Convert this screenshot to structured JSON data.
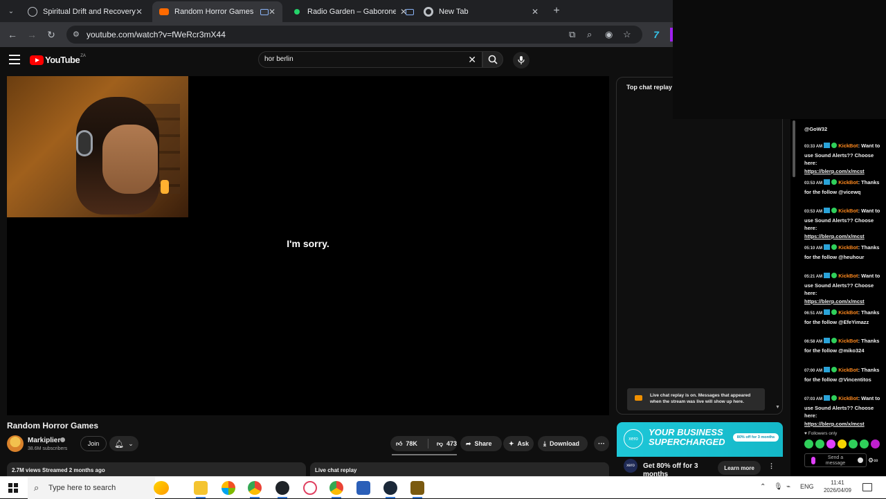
{
  "browser": {
    "tabs": [
      {
        "title": "Spiritual Drift and Recovery",
        "icon": "globe-icon",
        "active": false
      },
      {
        "title": "Random Horror Games - Yo",
        "icon": "youtube-icon",
        "active": true
      },
      {
        "title": "Radio Garden – Gaborone",
        "icon": "radio-garden-icon",
        "active": false
      },
      {
        "title": "New Tab",
        "icon": "chrome-icon",
        "active": false
      }
    ],
    "new_tab_label": "+",
    "url": "youtube.com/watch?v=fWeRcr3mX44"
  },
  "youtube": {
    "logo_text": "YouTube",
    "country_code": "ZA",
    "search_query": "hor berlin",
    "subtitle": "I'm sorry.",
    "video_title": "Random Horror Games",
    "channel": {
      "name": "Markiplier",
      "subscribers": "38.6M subscribers"
    },
    "join_label": "Join",
    "actions": {
      "likes": "78K",
      "dislikes": "473",
      "share": "Share",
      "ask": "Ask",
      "download": "Download",
      "more": "···"
    },
    "description_meta": "2.7M views  Streamed 2 months ago",
    "live_chat_replay_label": "Live chat replay",
    "chat": {
      "header": "Top chat replay",
      "replay_notice": "Live chat replay is on. Messages that appeared when the stream was live will show up here."
    },
    "ad": {
      "brand": "xero",
      "headline": "YOUR BUSINESS SUPERCHARGED",
      "offer_pill": "80% off for 3 months",
      "text": "Get 80% off for 3 months",
      "cta": "Learn more",
      "more": "⋮"
    }
  },
  "kick_chat": {
    "top_user": "@GoW32",
    "messages": [
      {
        "time": "03:33 AM",
        "user": "KickBot",
        "text": "Want to use Sound Alerts?? Choose here:",
        "link": "https://blerp.com/x/mcst"
      },
      {
        "time": "03:53 AM",
        "user": "KickBot",
        "text": "Thanks for the follow @vicewq",
        "link": ""
      },
      {
        "time": "03:53 AM",
        "user": "KickBot",
        "text": "Want to use Sound Alerts?? Choose here:",
        "link": "https://blerp.com/x/mcst"
      },
      {
        "time": "05:10 AM",
        "user": "KickBot",
        "text": "Thanks for the follow @heuhour",
        "link": ""
      },
      {
        "time": "05:21 AM",
        "user": "KickBot",
        "text": "Want to use Sound Alerts?? Choose here:",
        "link": "https://blerp.com/x/mcst"
      },
      {
        "time": "06:51 AM",
        "user": "KickBot",
        "text": "Thanks for the follow @EfeYimazz",
        "link": ""
      },
      {
        "time": "06:58 AM",
        "user": "KickBot",
        "text": "Thanks for the follow @miko324",
        "link": ""
      },
      {
        "time": "07:00 AM",
        "user": "KickBot",
        "text": "Thanks for the follow @Vincentitos",
        "link": ""
      },
      {
        "time": "07:03 AM",
        "user": "KickBot",
        "text": "Want to use Sound Alerts?? Choose here:",
        "link": "https://blerp.com/x/mcst"
      }
    ],
    "followers_only": "Followers only",
    "send_placeholder": "Send a message"
  },
  "taskbar": {
    "search_placeholder": "Type here to search",
    "language": "ENG",
    "time": "11:41",
    "date": "2026/04/09"
  }
}
